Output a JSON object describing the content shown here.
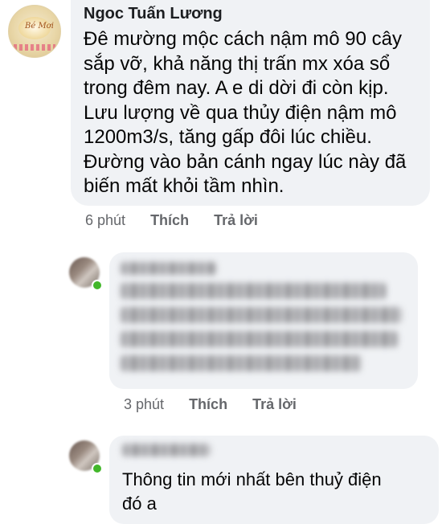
{
  "comment_1": {
    "author": "Ngoc Tuấn Lương",
    "text_lines": [
      "Đê mường mộc cách nậm mô 90 cây",
      "sắp vỡ, khả năng thị trấn mx xóa sổ",
      "trong đêm nay. A e di dời đi còn kịp.",
      "Lưu lượng về qua thủy điện nậm mô",
      "1200m3/s, tăng gấp đôi lúc chiều.",
      "Đường vào bản cánh ngay lúc này đã",
      "biến mất khỏi tầm nhìn."
    ],
    "time": "6 phút",
    "like_label": "Thích",
    "reply_label": "Trả lời"
  },
  "comment_2": {
    "time": "3 phút",
    "like_label": "Thích",
    "reply_label": "Trả lời"
  },
  "comment_3": {
    "text_lines": [
      "Thông tin mới nhất bên thuỷ điện",
      "đó a"
    ]
  },
  "colors": {
    "bubble": "#f0f2f5",
    "meta_text": "#65676b",
    "online": "#42b72a"
  }
}
